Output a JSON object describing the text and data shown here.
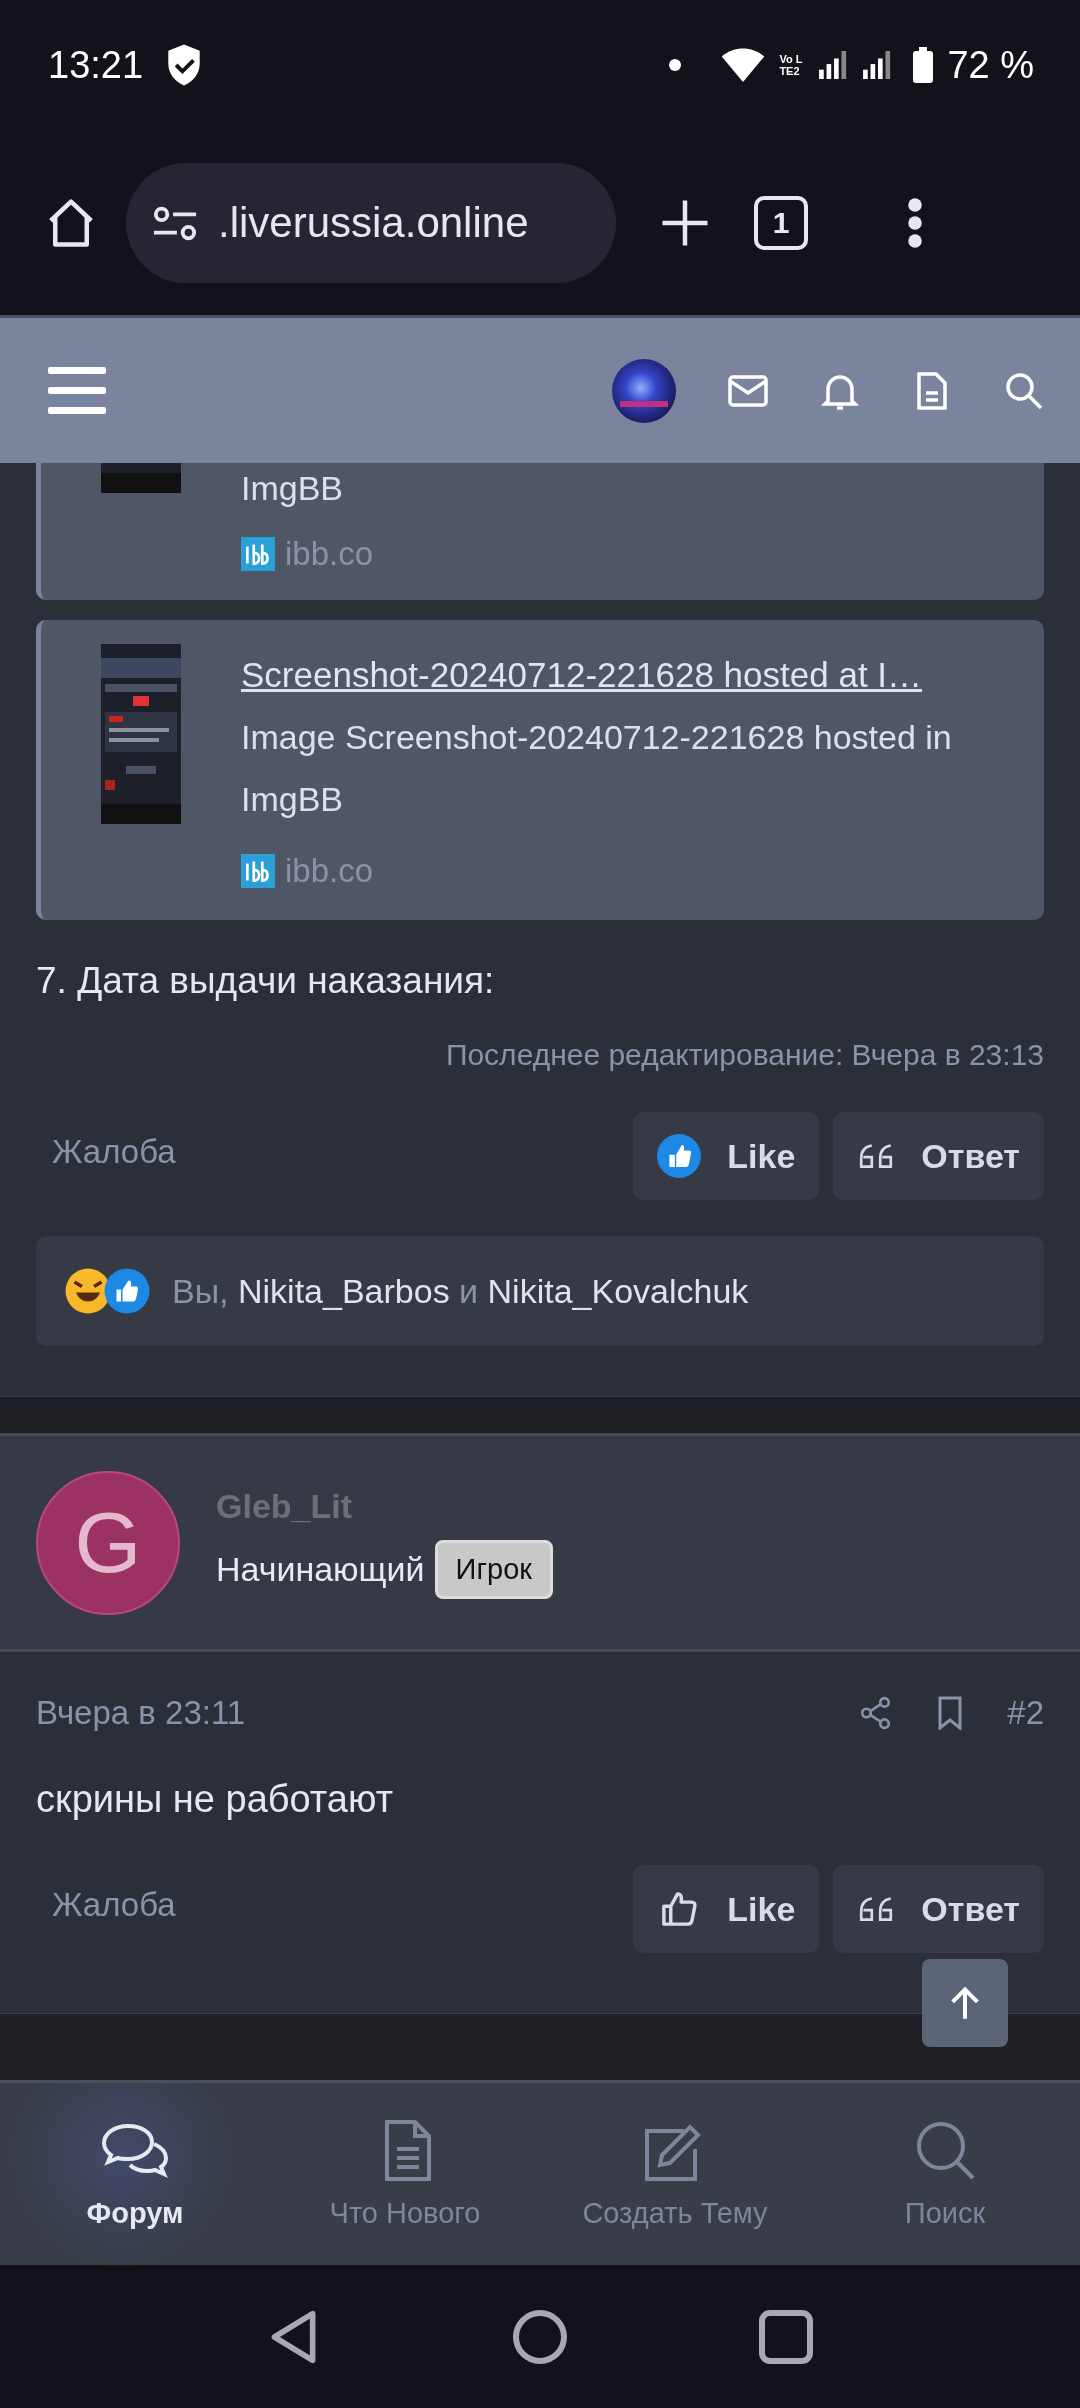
{
  "status_bar": {
    "time": "13:21",
    "network_label": "Vo LTE2",
    "battery": "72 %"
  },
  "browser": {
    "url": ".liverussia.online",
    "tab_count": "1"
  },
  "link_cards": [
    {
      "kind": "cut",
      "description": "ImgBB",
      "domain": "ibb.co"
    },
    {
      "kind": "full",
      "title": "Screenshot-20240712-221628 hosted at I…",
      "description": "Image Screenshot-20240712-221628 hosted in ImgBB",
      "domain": "ibb.co"
    }
  ],
  "post_1": {
    "text": "7. Дата выдачи наказания:",
    "edited": "Последнее редактирование: Вчера в 23:13",
    "report": "Жалоба",
    "like": {
      "label": "Like",
      "liked": true
    },
    "reply": "Ответ",
    "reactions": [
      {
        "kind": "text",
        "text": "Вы, "
      },
      {
        "kind": "user",
        "text": "Nikita_Barbos"
      },
      {
        "kind": "text",
        "text": " и "
      },
      {
        "kind": "user",
        "text": "Nikita_Kovalchuk"
      }
    ]
  },
  "post_2": {
    "author": "Gleb_Lit",
    "avatar_letter": "G",
    "user_title": "Начинающий",
    "badge": "Игрок",
    "date": "Вчера в 23:11",
    "number": "#2",
    "text": "скрины не работают",
    "report": "Жалоба",
    "like": {
      "label": "Like",
      "liked": false
    },
    "reply": "Ответ"
  },
  "bottom_nav": [
    {
      "label": "Форум",
      "selected": true
    },
    {
      "label": "Что Нового",
      "selected": false
    },
    {
      "label": "Создать Тему",
      "selected": false
    },
    {
      "label": "Поиск",
      "selected": false
    }
  ]
}
